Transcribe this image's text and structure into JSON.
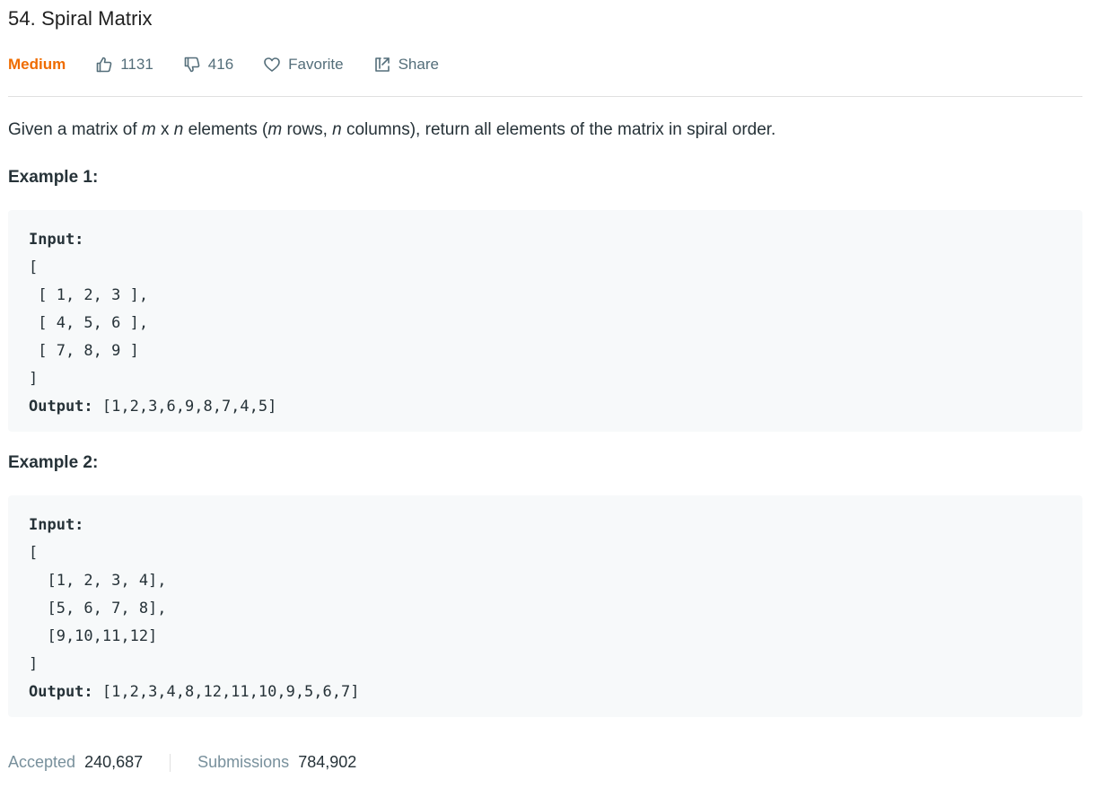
{
  "problem": {
    "title": "54. Spiral Matrix",
    "difficulty": "Medium",
    "likes": "1131",
    "dislikes": "416",
    "favorite_label": "Favorite",
    "share_label": "Share"
  },
  "description": {
    "part1": "Given a matrix of ",
    "m1": "m",
    "x": " x ",
    "n1": "n",
    "part2": " elements (",
    "m2": "m",
    "part3": " rows, ",
    "n2": "n",
    "part4": " columns), return all elements of the matrix in spiral order."
  },
  "examples": [
    {
      "heading": "Example 1:",
      "input_label": "Input:",
      "input_lines": [
        "[",
        " [ 1, 2, 3 ],",
        " [ 4, 5, 6 ],",
        " [ 7, 8, 9 ]",
        "]"
      ],
      "output_label": "Output:",
      "output_value": " [1,2,3,6,9,8,7,4,5]"
    },
    {
      "heading": "Example 2:",
      "input_label": "Input:",
      "input_lines": [
        "[",
        "  [1, 2, 3, 4],",
        "  [5, 6, 7, 8],",
        "  [9,10,11,12]",
        "]"
      ],
      "output_label": "Output:",
      "output_value": " [1,2,3,4,8,12,11,10,9,5,6,7]"
    }
  ],
  "stats": {
    "accepted_label": "Accepted",
    "accepted_value": "240,687",
    "submissions_label": "Submissions",
    "submissions_value": "784,902"
  },
  "colors": {
    "difficulty_medium": "#ef6c00",
    "code_background": "#f7f9fa",
    "muted_text": "#78909c"
  },
  "icons": {
    "like": "thumbs-up-icon",
    "dislike": "thumbs-down-icon",
    "favorite": "heart-icon",
    "share": "share-icon"
  }
}
